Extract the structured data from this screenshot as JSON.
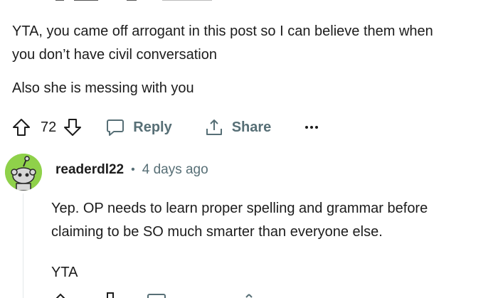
{
  "comment1": {
    "paragraphs": [
      "YTA, you came off arrogant in this post so I can believe them when",
      "you don’t have civil conversation",
      "Also she is messing with you"
    ],
    "actions": {
      "score": "72",
      "reply_label": "Reply",
      "share_label": "Share"
    }
  },
  "comment2": {
    "username": "readerdl22",
    "separator": "•",
    "timestamp": "4 days ago",
    "paragraphs": [
      "Yep. OP needs to learn proper spelling and grammar before",
      "claiming to be SO much smarter than everyone else.",
      "YTA"
    ]
  },
  "icons": {
    "upvote": "arrow-up-icon",
    "downvote": "arrow-down-icon",
    "reply": "chat-bubble-icon",
    "share": "share-icon",
    "more": "more-dots-icon"
  },
  "colors": {
    "avatar_bg": "#8fd14a",
    "meta_gray": "#576f76",
    "text": "#1c1c1c"
  }
}
